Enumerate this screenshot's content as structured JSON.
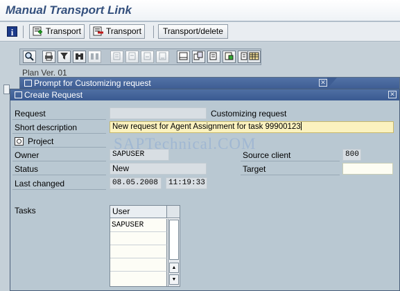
{
  "window": {
    "title": "Manual Transport Link"
  },
  "app_toolbar": {
    "info_icon": "i",
    "transport1_label": "Transport",
    "transport2_label": "Transport",
    "transport_delete_label": "Transport/delete"
  },
  "background": {
    "plan_label": "Plan Ver. 01",
    "toolbar_icons": [
      "search-icon",
      "print-icon",
      "filter-icon",
      "find-icon",
      "find-next-icon",
      "first-page-icon",
      "prev-page-icon",
      "next-page-icon",
      "last-page-icon",
      "details-icon",
      "copy-icon",
      "export-icon",
      "sum-icon",
      "table-icon"
    ]
  },
  "prompt_dialog": {
    "title": "Prompt for Customizing request"
  },
  "create_request": {
    "title": "Create Request",
    "request_label": "Request",
    "request_value": "",
    "request_type": "Customizing request",
    "short_desc_label": "Short description",
    "short_desc_value": "New request for Agent Assignment for task 99900123",
    "project_label": "Project",
    "owner_label": "Owner",
    "owner_value": "SAPUSER",
    "source_client_label": "Source client",
    "source_client_value": "800",
    "status_label": "Status",
    "status_value": "New",
    "target_label": "Target",
    "target_value": "",
    "last_changed_label": "Last changed",
    "last_changed_date": "08.05.2008",
    "last_changed_time": "11:19:33",
    "tasks_label": "Tasks",
    "tasks_table": {
      "header": "User",
      "rows": [
        "SAPUSER",
        "",
        "",
        "",
        ""
      ]
    }
  },
  "watermark": "SAPTechnical.COM"
}
